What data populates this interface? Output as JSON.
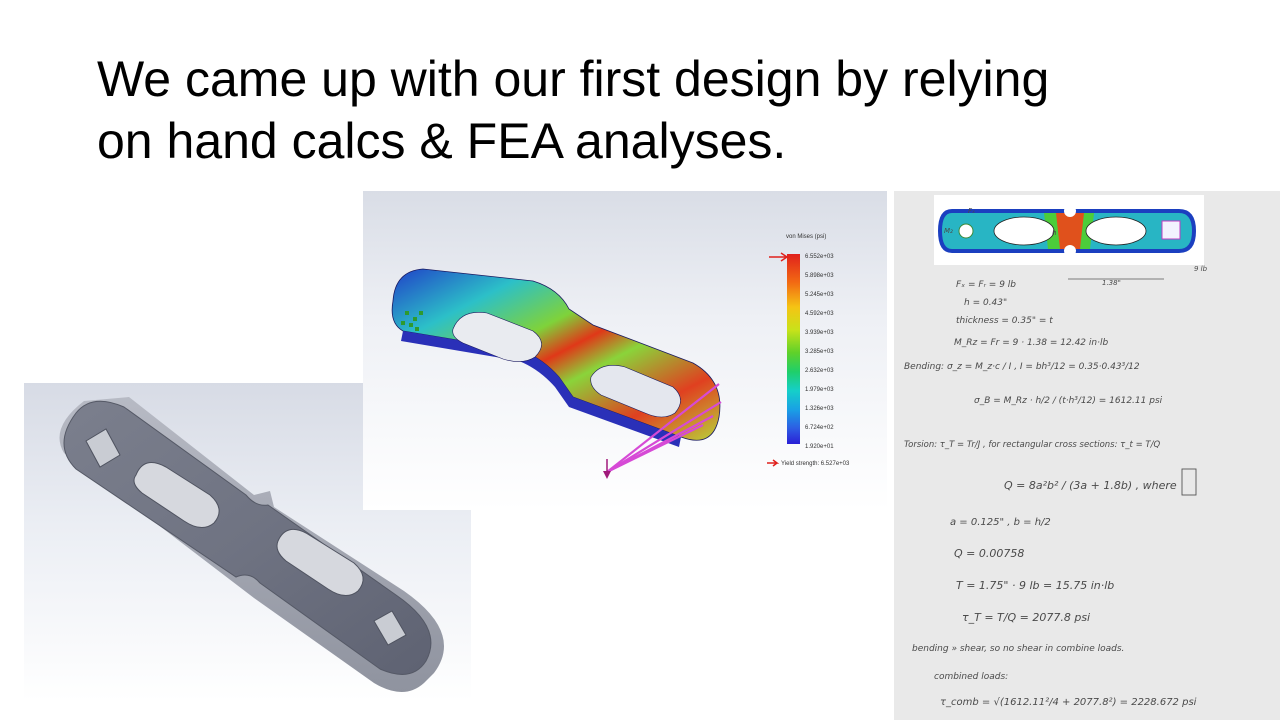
{
  "slide": {
    "title_line1": "We came up with our first design by relying",
    "title_line2": "on hand calcs & FEA analyses."
  },
  "fea": {
    "legend_title": "von Mises (psi)",
    "legend_values": [
      "6.552e+03",
      "5.898e+03",
      "5.245e+03",
      "4.592e+03",
      "3.939e+03",
      "3.285e+03",
      "2.632e+03",
      "1.979e+03",
      "1.326e+03",
      "6.724e+02",
      "1.920e+01"
    ],
    "yield_label": "Yield strength: 6.527e+03",
    "colors": [
      "#e0211c",
      "#f26a13",
      "#f5c414",
      "#c8e21a",
      "#5fd12a",
      "#1fcf6a",
      "#15cfc9",
      "#19a0e5",
      "#2d5be3",
      "#2a1fd6"
    ]
  },
  "calcs": {
    "fig_labels": {
      "fx": "Fₓ",
      "mz": "M₂",
      "h": "h",
      "nine_lb": "9 lb",
      "dim": "1.38\""
    },
    "lines": [
      "Fₓ = Fᵣ = 9 lb",
      "h = 0.43\"",
      "thickness = 0.35\" = t",
      "M_Rz = Fr = 9 · 1.38 = 12.42 in·lb",
      "Bending:  σ_z = M_z·c / I ,  I = bh³/12 = 0.35·0.43³/12",
      "σ_B = M_Rz · h/2 / (t·h³/12) = 1612.11 psi",
      "Torsion:  τ_T = Tr/J , for rectangular cross sections: τ_t = T/Q",
      "Q = 8a²b² / (3a + 1.8b) ,  where",
      "a = 0.125\" ,  b = h/2",
      "Q = 0.00758",
      "T = 1.75\" · 9 lb = 15.75 in·lb",
      "τ_T = T/Q = 2077.8 psi",
      "bending » shear, so no shear in combine loads.",
      "combined loads:",
      "τ_comb = √(1612.11²/4 + 2077.8²) = 2228.672 psi"
    ]
  }
}
